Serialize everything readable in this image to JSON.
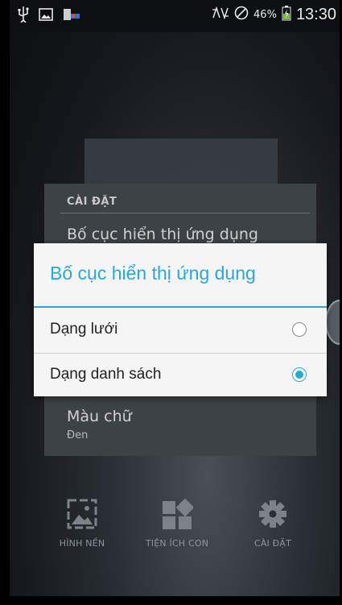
{
  "status_bar": {
    "battery_percent": "46%",
    "time": "13:30",
    "icons": [
      "usb-icon",
      "image-icon",
      "notification-icon",
      "nfc-icon",
      "dnd-icon",
      "battery-charging-icon"
    ]
  },
  "settings_panel": {
    "header": "CÀI ĐẶT",
    "item1_title": "Bố cục hiển thị ứng dụng",
    "item2_title": "Màu chữ",
    "item2_value": "Đen"
  },
  "dialog": {
    "title": "Bố cục hiển thị ứng dụng",
    "options": [
      {
        "label": "Dạng lưới",
        "selected": false
      },
      {
        "label": "Dạng danh sách",
        "selected": true
      }
    ]
  },
  "dock": [
    {
      "label": "HÌNH NỀN",
      "icon": "wallpaper-icon"
    },
    {
      "label": "TIỆN ÍCH CON",
      "icon": "widgets-icon"
    },
    {
      "label": "CÀI ĐẶT",
      "icon": "settings-gear-icon"
    }
  ],
  "colors": {
    "accent": "#2aa8d8",
    "dialog_bg": "#f5f5f5",
    "panel_bg": "#3d4247"
  }
}
